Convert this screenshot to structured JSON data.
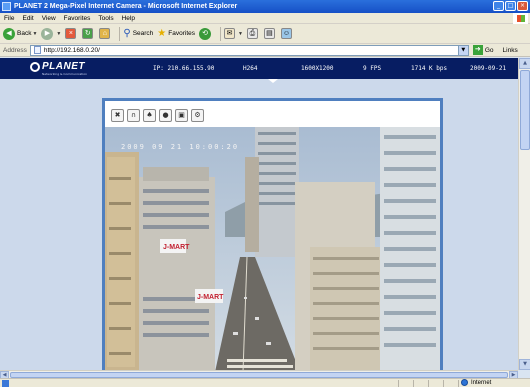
{
  "window": {
    "title": "PLANET 2 Mega-Pixel Internet Camera - Microsoft Internet Explorer",
    "buttons": [
      "_",
      "□",
      "×"
    ]
  },
  "menu": [
    "File",
    "Edit",
    "View",
    "Favorites",
    "Tools",
    "Help"
  ],
  "toolbar": {
    "back_label": "Back",
    "search_label": "Search",
    "favorites_label": "Favorites"
  },
  "address": {
    "label": "Address",
    "url": "http://192.168.0.20/",
    "go_label": "Go",
    "links_label": "Links"
  },
  "camera_header": {
    "brand": "PLANET",
    "brand_tagline": "Networking & Communication",
    "ip": "IP: 210.66.155.90",
    "codec": "H264",
    "resolution": "1600X1200",
    "fps": "9 FPS",
    "bitrate": "1714 K bps",
    "date": "2009-09-21"
  },
  "viewer": {
    "controls": [
      {
        "name": "fullscreen-button",
        "icon": "✖"
      },
      {
        "name": "audio-listen-button",
        "icon": "∩"
      },
      {
        "name": "microphone-button",
        "icon": "♠"
      },
      {
        "name": "record-button",
        "icon": "●"
      },
      {
        "name": "snapshot-button",
        "icon": "▣"
      },
      {
        "name": "settings-button",
        "icon": "⚙"
      }
    ],
    "osd_timestamp": "2009 09 21  10:00:20",
    "signs": {
      "sign1": "J-MART",
      "sign2": "J-MART"
    }
  },
  "status": {
    "zone": "Internet"
  },
  "colors": {
    "header_bg": "#071d62",
    "viewer_border": "#4f7fbf",
    "page_bg": "#ccd9eb"
  }
}
